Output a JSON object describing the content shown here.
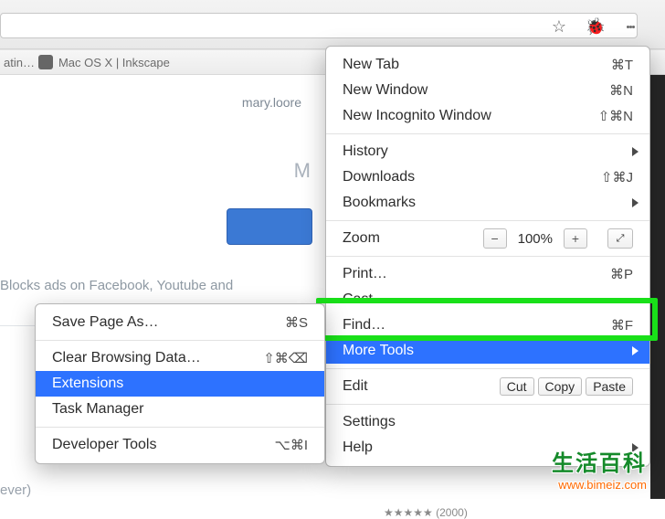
{
  "toolbar": {
    "bookmark_fragment": "atin…",
    "bookmark_title": "Mac OS X | Inkscape"
  },
  "page": {
    "email": "mary.loore",
    "m": "M",
    "desc": "Blocks ads on Facebook, Youtube and",
    "ever": "ever)",
    "stars": "★★★★★  (2000)"
  },
  "menu": {
    "new_tab": "New Tab",
    "new_tab_sc": "⌘T",
    "new_win": "New Window",
    "new_win_sc": "⌘N",
    "new_incog": "New Incognito Window",
    "new_incog_sc": "⇧⌘N",
    "history": "History",
    "downloads": "Downloads",
    "downloads_sc": "⇧⌘J",
    "bookmarks": "Bookmarks",
    "zoom": "Zoom",
    "zoom_val": "100%",
    "print": "Print…",
    "print_sc": "⌘P",
    "cast": "Cast…",
    "find": "Find…",
    "find_sc": "⌘F",
    "more_tools": "More Tools",
    "edit": "Edit",
    "cut": "Cut",
    "copy": "Copy",
    "paste": "Paste",
    "settings": "Settings",
    "help": "Help"
  },
  "submenu": {
    "save_as": "Save Page As…",
    "save_as_sc": "⌘S",
    "clear": "Clear Browsing Data…",
    "clear_sc": "⇧⌘⌫",
    "extensions": "Extensions",
    "task_mgr": "Task Manager",
    "dev_tools": "Developer Tools",
    "dev_tools_sc": "⌥⌘I"
  },
  "watermark": {
    "cn": "生活百科",
    "url": "www.bimeiz.com"
  }
}
